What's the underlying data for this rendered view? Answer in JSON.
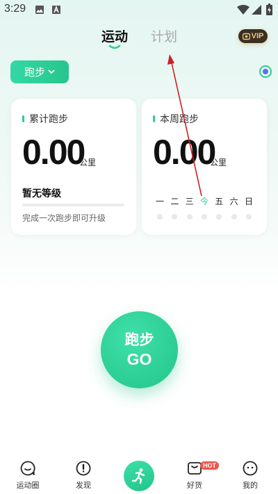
{
  "status_bar": {
    "time": "3:29"
  },
  "tabs": [
    {
      "label": "运动",
      "active": true
    },
    {
      "label": "计划",
      "active": false
    }
  ],
  "vip": {
    "label": "VIP"
  },
  "mode_selector": {
    "label": "跑步"
  },
  "cards": {
    "total": {
      "title": "累计跑步",
      "distance": "0.00",
      "unit": "公里",
      "level": "暂无等级",
      "level_progress": 0,
      "hint": "完成一次跑步即可升级"
    },
    "weekly": {
      "title": "本周跑步",
      "distance": "0.00",
      "unit": "公里",
      "days": [
        "一",
        "二",
        "三",
        "今",
        "五",
        "六",
        "日"
      ]
    }
  },
  "go_button": {
    "line1": "跑步",
    "line2": "GO"
  },
  "bottom_nav": {
    "items": [
      {
        "label": "运动圈",
        "icon": "chat-bubble-icon"
      },
      {
        "label": "发现",
        "icon": "compass-icon"
      },
      {
        "label": "",
        "icon": "runner-icon"
      },
      {
        "label": "好货",
        "icon": "shop-bag-icon",
        "badge": "HOT"
      },
      {
        "label": "我的",
        "icon": "face-icon"
      }
    ]
  },
  "colors": {
    "accent": "#2fcc93",
    "vip_bg": "#3a2f22",
    "vip_text": "#f1c97a",
    "hot": "#f0564a",
    "annotation_arrow": "#cc1f1f"
  }
}
